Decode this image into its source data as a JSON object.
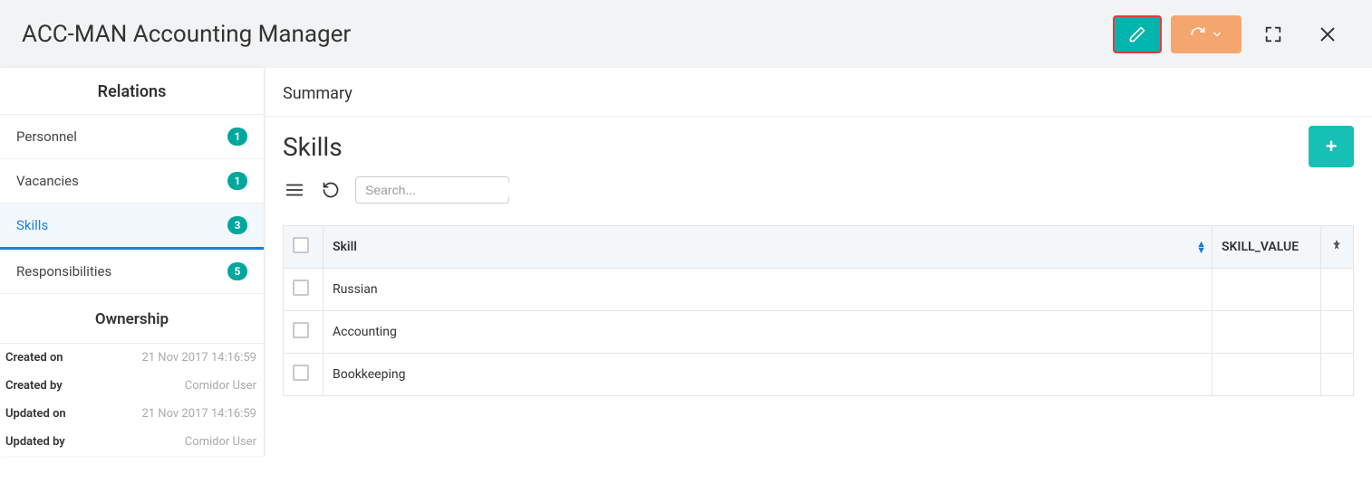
{
  "header": {
    "title": "ACC-MAN Accounting Manager"
  },
  "sidebar": {
    "relations_title": "Relations",
    "items": [
      {
        "label": "Personnel",
        "count": "1",
        "active": false
      },
      {
        "label": "Vacancies",
        "count": "1",
        "active": false
      },
      {
        "label": "Skills",
        "count": "3",
        "active": true
      },
      {
        "label": "Responsibilities",
        "count": "5",
        "active": false
      }
    ],
    "ownership_title": "Ownership",
    "meta": [
      {
        "label": "Created on",
        "value": "21 Nov 2017 14:16:59"
      },
      {
        "label": "Created by",
        "value": "Comidor User"
      },
      {
        "label": "Updated on",
        "value": "21 Nov 2017 14:16:59"
      },
      {
        "label": "Updated by",
        "value": "Comidor User"
      }
    ]
  },
  "content": {
    "summary_label": "Summary",
    "panel_title": "Skills",
    "search_placeholder": "Search...",
    "table": {
      "columns": {
        "skill": "Skill",
        "skill_value": "SKILL_VALUE"
      },
      "rows": [
        {
          "skill": "Russian"
        },
        {
          "skill": "Accounting"
        },
        {
          "skill": "Bookkeeping"
        }
      ]
    }
  }
}
